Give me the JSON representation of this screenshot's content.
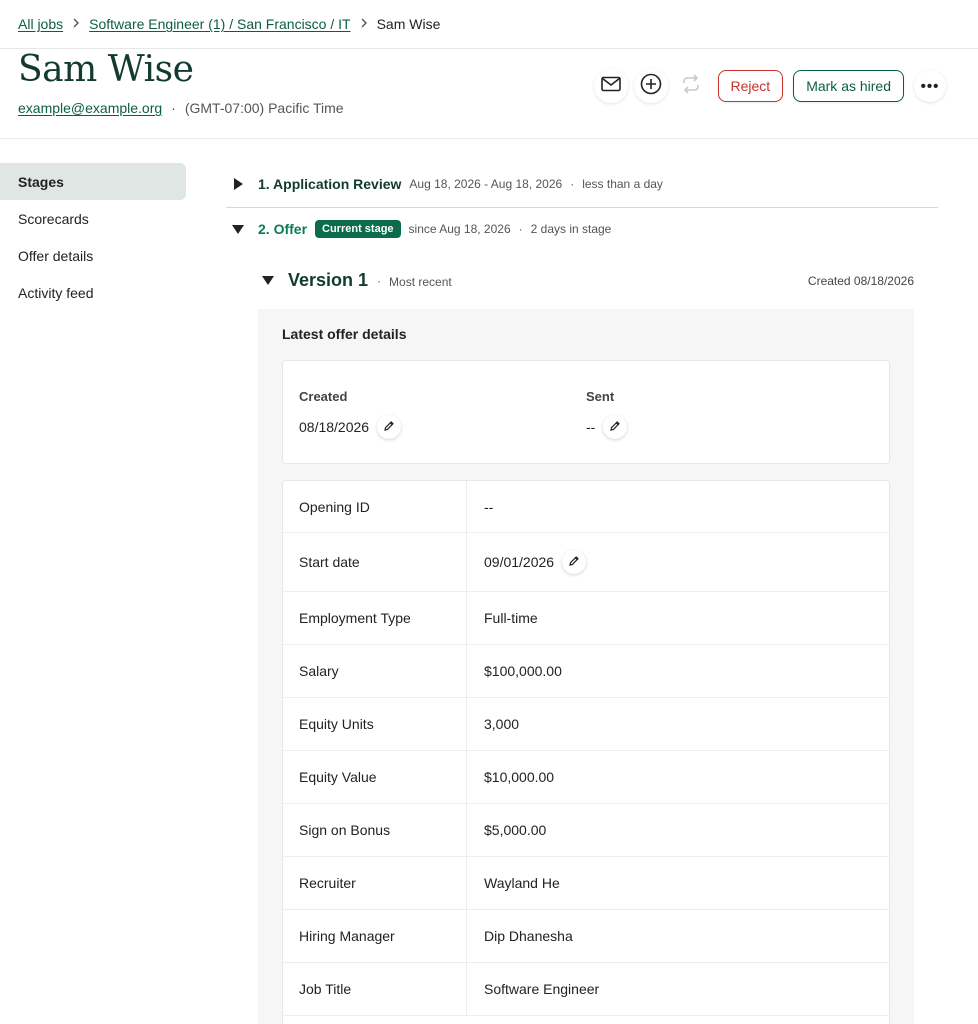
{
  "breadcrumb": {
    "all_jobs": "All jobs",
    "job_path": "Software Engineer (1) / San Francisco / IT",
    "current": "Sam Wise"
  },
  "candidate": {
    "name": "Sam Wise",
    "email": "example@example.org",
    "timezone": "(GMT-07:00) Pacific Time"
  },
  "actions": {
    "reject_label": "Reject",
    "hired_label": "Mark as hired",
    "more_label": "•••"
  },
  "sidebar": {
    "items": [
      {
        "label": "Stages",
        "active": true
      },
      {
        "label": "Scorecards",
        "active": false
      },
      {
        "label": "Offer details",
        "active": false
      },
      {
        "label": "Activity feed",
        "active": false
      }
    ]
  },
  "stages": [
    {
      "title": "1. Application Review",
      "dates": "Aug 18, 2026 - Aug 18, 2026",
      "duration": "less than a day"
    },
    {
      "title": "2. Offer",
      "badge": "Current stage",
      "since": "since Aug 18, 2026",
      "duration": "2 days in stage"
    }
  ],
  "version": {
    "title": "Version 1",
    "tag": "Most recent",
    "created": "Created 08/18/2026"
  },
  "offer": {
    "heading": "Latest offer details",
    "created_label": "Created",
    "created_value": "08/18/2026",
    "sent_label": "Sent",
    "sent_value": "--",
    "rows": [
      {
        "label": "Opening ID",
        "value": "--"
      },
      {
        "label": "Start date",
        "value": "09/01/2026"
      },
      {
        "label": "Employment Type",
        "value": "Full-time"
      },
      {
        "label": "Salary",
        "value": "$100,000.00"
      },
      {
        "label": "Equity Units",
        "value": "3,000"
      },
      {
        "label": "Equity Value",
        "value": "$10,000.00"
      },
      {
        "label": "Sign on Bonus",
        "value": "$5,000.00"
      },
      {
        "label": "Recruiter",
        "value": "Wayland He"
      },
      {
        "label": "Hiring Manager",
        "value": "Dip Dhanesha"
      },
      {
        "label": "Job Title",
        "value": "Software Engineer"
      }
    ]
  },
  "icons": {
    "email": "mail-icon",
    "add": "plus-circle-icon",
    "transfer": "refresh-icon",
    "edit": "pencil-icon",
    "breadcrumb_separator": "chevron-right-icon",
    "collapsed": "triangle-right-icon",
    "expanded": "triangle-down-icon"
  },
  "colors": {
    "brand_green": "#0b5e46",
    "badge_green": "#0b6b4d",
    "reject_red": "#c8342a",
    "active_sidebar": "#dfe6e3"
  }
}
